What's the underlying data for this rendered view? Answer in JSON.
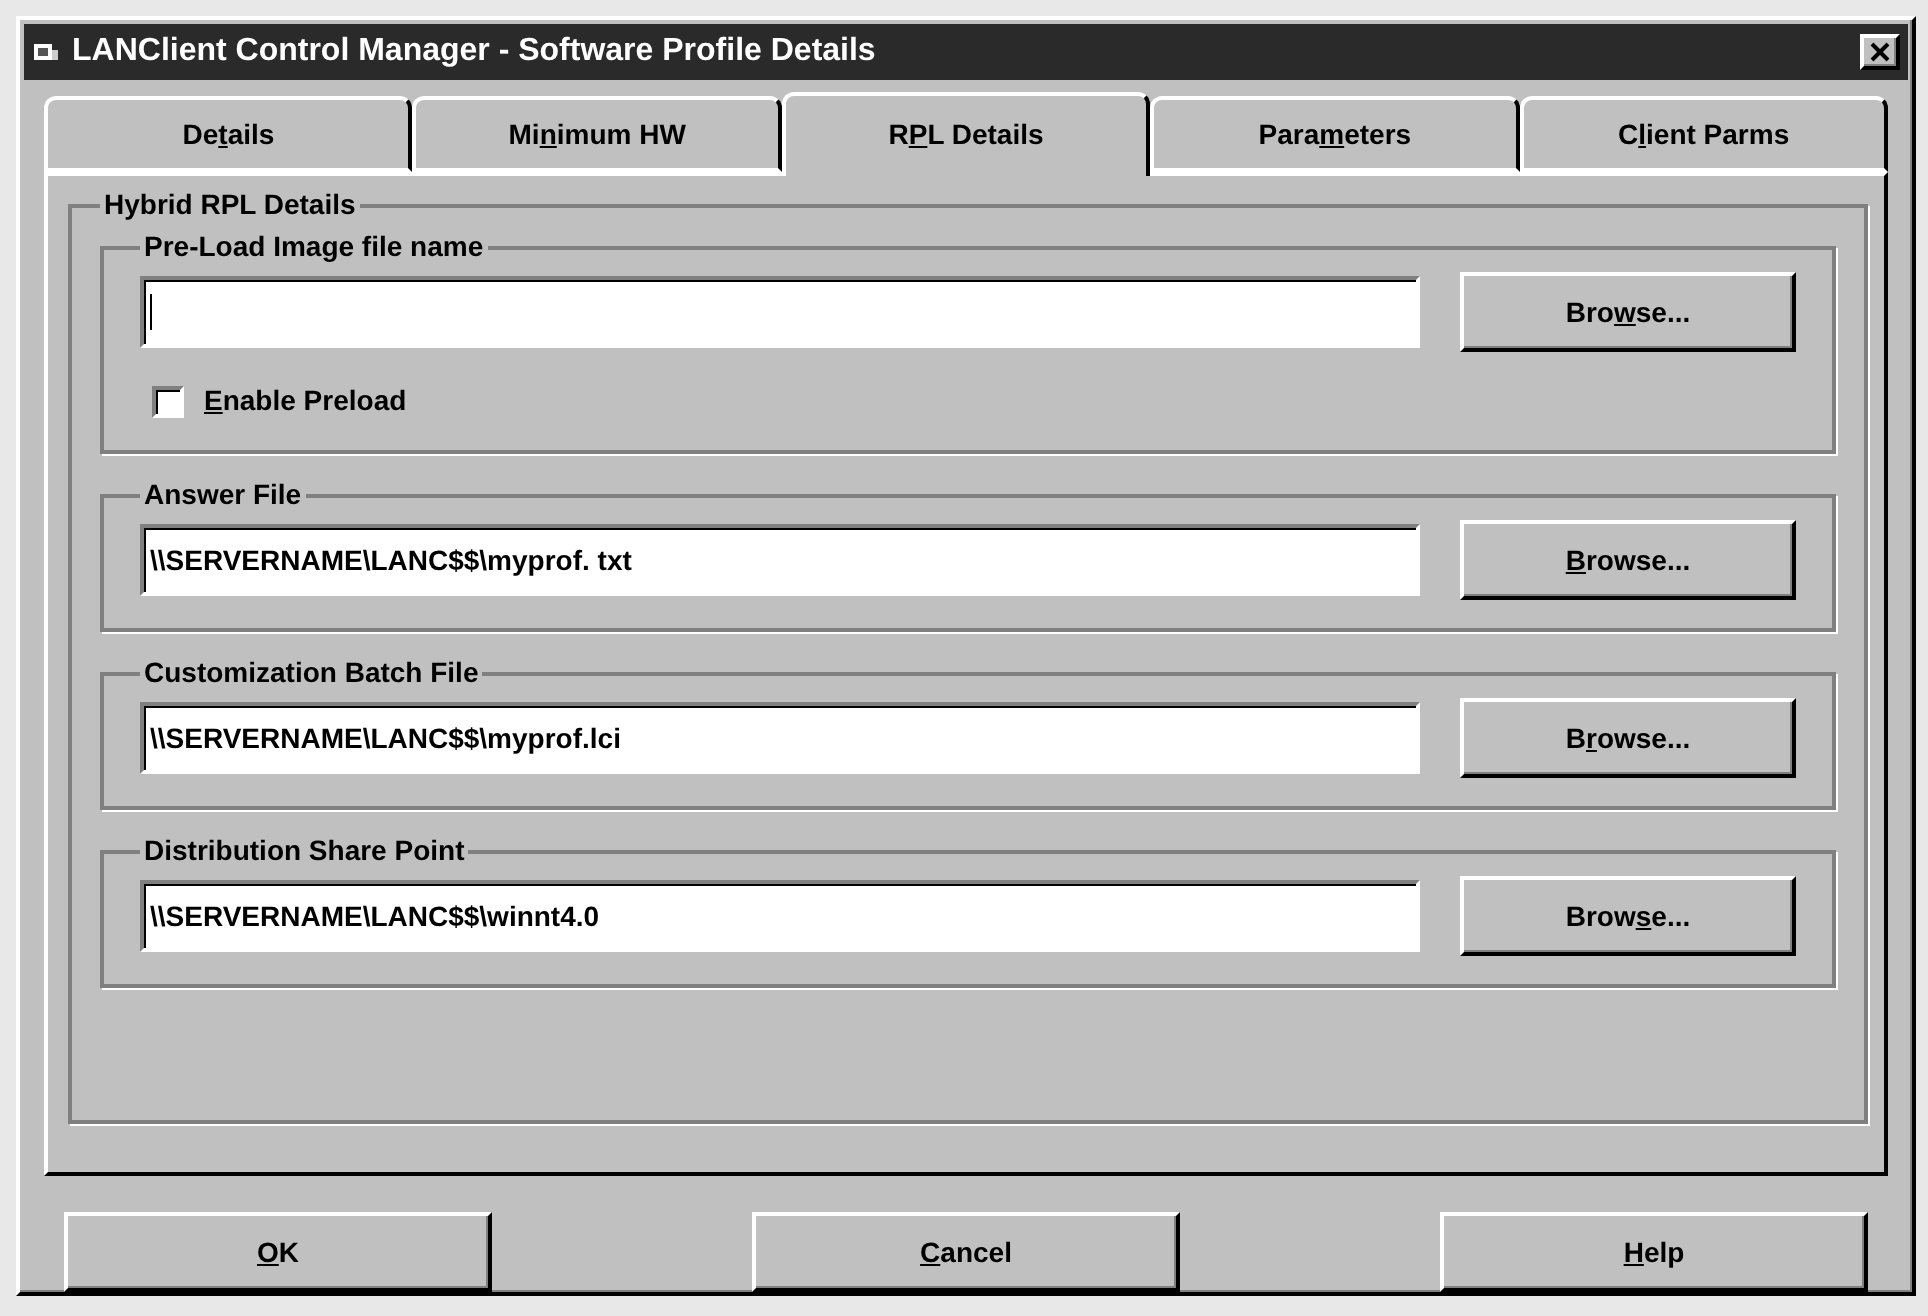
{
  "window": {
    "title": "LANClient Control Manager - Software Profile Details"
  },
  "tabs": [
    {
      "label": {
        "before": "De",
        "key": "t",
        "after": "ails"
      },
      "selected": false
    },
    {
      "label": {
        "before": "Mi",
        "key": "n",
        "after": "imum HW"
      },
      "selected": false
    },
    {
      "label": {
        "before": "R",
        "key": "P",
        "after": "L Details"
      },
      "selected": true
    },
    {
      "label": {
        "before": "Para",
        "key": "m",
        "after": "eters"
      },
      "selected": false
    },
    {
      "label": {
        "before": "C",
        "key": "l",
        "after": "ient Parms"
      },
      "selected": false
    }
  ],
  "panel": {
    "title": "Hybrid RPL Details",
    "groups": [
      {
        "title": "Pre-Load Image file name",
        "focused": true,
        "browse": {
          "before": "Bro",
          "key": "w",
          "after": "se..."
        },
        "checkbox": {
          "label": {
            "key": "E",
            "after": "nable Preload"
          },
          "checked": false
        }
      },
      {
        "title": "Answer File",
        "value": "\\\\SERVERNAME\\LANC$$\\myprof. txt",
        "focused": false,
        "browse": {
          "key": "B",
          "after": "rowse..."
        }
      },
      {
        "title": "Customization Batch File",
        "value": "\\\\SERVERNAME\\LANC$$\\myprof.lci",
        "focused": false,
        "browse": {
          "before": "B",
          "key": "r",
          "after": "owse..."
        }
      },
      {
        "title": "Distribution Share Point",
        "value": "\\\\SERVERNAME\\LANC$$\\winnt4.0",
        "focused": false,
        "browse": {
          "before": "Brow",
          "key": "s",
          "after": "e..."
        }
      }
    ]
  },
  "buttons": [
    {
      "label": {
        "key": "O",
        "after": "K"
      }
    },
    {
      "label": {
        "key": "C",
        "after": "ancel"
      }
    },
    {
      "label": {
        "key": "H",
        "after": "elp"
      }
    }
  ]
}
